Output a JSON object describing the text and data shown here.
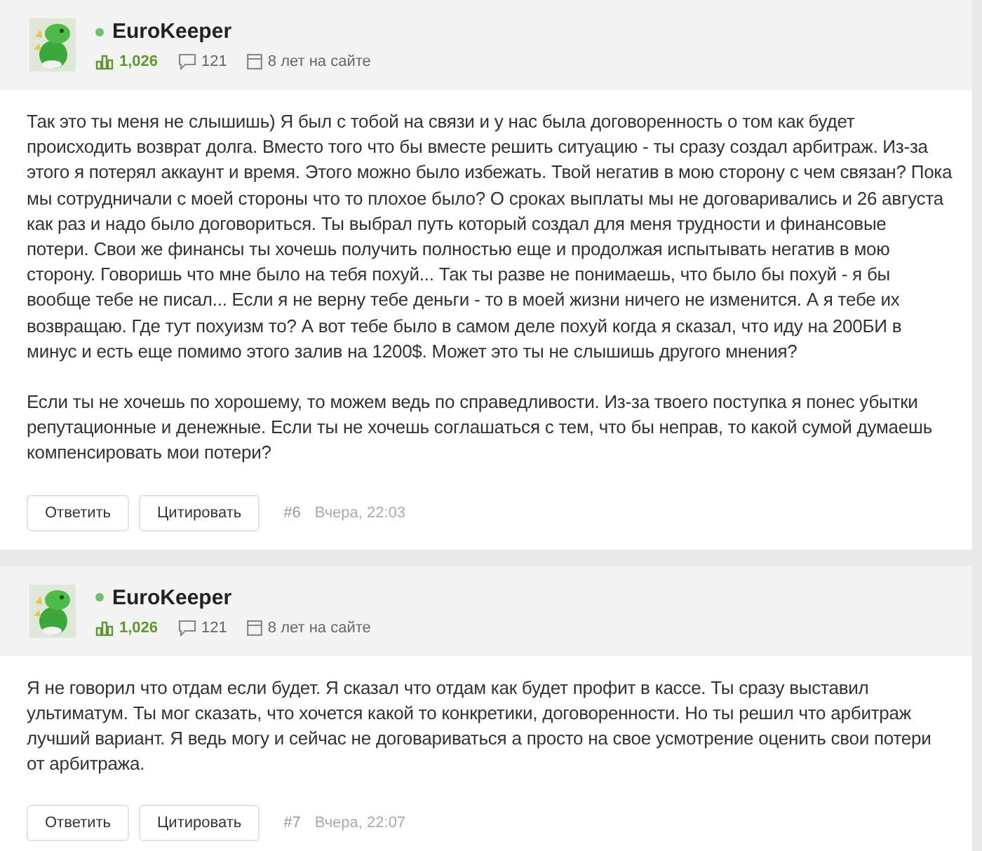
{
  "posts": [
    {
      "author": {
        "name": "EuroKeeper",
        "online": true,
        "rating": "1,026",
        "comments": "121",
        "age": "8 лет на сайте"
      },
      "paragraphs": [
        "Так это ты меня не слышишь) Я был с тобой на связи и у нас была договоренность о том как будет происходить возврат долга. Вместо того что бы вместе решить ситуацию - ты сразу создал арбитраж. Из-за этого я потерял аккаунт и время. Этого можно было избежать. Твой негатив в мою сторону с чем связан? Пока мы сотрудничали с моей стороны что то плохое было? О сроках выплаты мы не договаривались и 26 августа как раз и надо было договориться. Ты выбрал путь который создал для меня трудности и финансовые потери. Свои же финансы ты хочешь получить полностью еще и продолжая испытывать негатив в мою сторону. Говоришь что мне было на тебя похуй... Так ты разве не понимаешь, что было бы похуй - я бы вообще тебе не писал... Если я не верну тебе деньги - то в моей жизни ничего не изменится. А я тебе их возвращаю. Где тут похуизм то? А вот тебе было в самом деле похуй когда я сказал, что иду на 200БИ в минус и есть еще помимо этого залив на 1200$. Может это ты не слышишь другого мнения?",
        "Если ты не хочешь по хорошему, то можем ведь по справедливости. Из-за твоего поступка я понес убытки репутационные и денежные. Если ты не хочешь соглашаться с тем, что бы неправ, то какой сумой думаешь компенсировать мои потери?"
      ],
      "buttons": [
        "Ответить",
        "Цитировать"
      ],
      "number": "#6",
      "time": "Вчера, 22:03"
    },
    {
      "author": {
        "name": "EuroKeeper",
        "online": true,
        "rating": "1,026",
        "comments": "121",
        "age": "8 лет на сайте"
      },
      "paragraphs": [
        "Я не говорил что отдам если будет. Я сказал что отдам как будет профит в кассе. Ты сразу выставил ультиматум. Ты мог сказать, что хочется какой то конкретики, договоренности. Но ты решил что арбитраж лучший вариант. Я ведь могу и сейчас не договариваться а просто на свое усмотрение оценить свои потери от арбитража."
      ],
      "buttons": [
        "Ответить",
        "Цитировать"
      ],
      "number": "#7",
      "time": "Вчера, 22:07"
    }
  ]
}
